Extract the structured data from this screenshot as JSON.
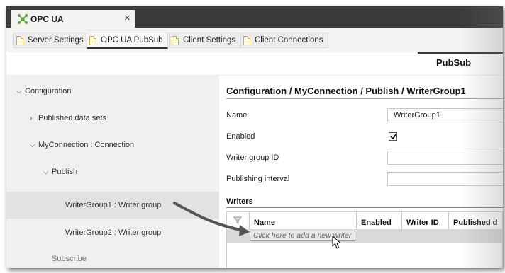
{
  "window": {
    "tab_title": "OPC UA",
    "close_glyph": "×",
    "logo_icon": "opc-ua-logo-icon"
  },
  "tabs": [
    {
      "label": "Server Settings",
      "active": false,
      "icon": "document-icon"
    },
    {
      "label": "OPC UA PubSub",
      "active": true,
      "icon": "document-icon"
    },
    {
      "label": "Client Settings",
      "active": false,
      "icon": "document-icon"
    },
    {
      "label": "Client Connections",
      "active": false,
      "icon": "document-icon"
    }
  ],
  "page": {
    "title": "PubSub"
  },
  "tree": [
    {
      "label": "Configuration",
      "chevron": "down"
    },
    {
      "label": "Published data sets",
      "chevron": "right"
    },
    {
      "label": "MyConnection : Connection",
      "chevron": "down"
    },
    {
      "label": "Publish",
      "chevron": "down"
    },
    {
      "label": "WriterGroup1 : Writer group",
      "chevron": "",
      "selected": true
    },
    {
      "label": "WriterGroup2 : Writer group",
      "chevron": ""
    },
    {
      "label": "Subscribe",
      "chevron": ""
    }
  ],
  "detail": {
    "breadcrumb": "Configuration / MyConnection / Publish / WriterGroup1",
    "fields": {
      "name_label": "Name",
      "name_value": "WriterGroup1",
      "enabled_label": "Enabled",
      "enabled_checked": true,
      "writer_group_id_label": "Writer group ID",
      "writer_group_id_value": "",
      "publishing_interval_label": "Publishing interval",
      "publishing_interval_value": ""
    },
    "writers": {
      "section_title": "Writers",
      "columns": [
        "Name",
        "Enabled",
        "Writer ID",
        "Published d"
      ],
      "new_row_placeholder": "Click here to add a new writer"
    }
  },
  "colors": {
    "titlebar": "#3b3b3b",
    "sidebar_bg": "#f0f0f0",
    "selected_row": "#e2e2e2",
    "logo_green": "#5aa832",
    "arrow": "#555555"
  }
}
